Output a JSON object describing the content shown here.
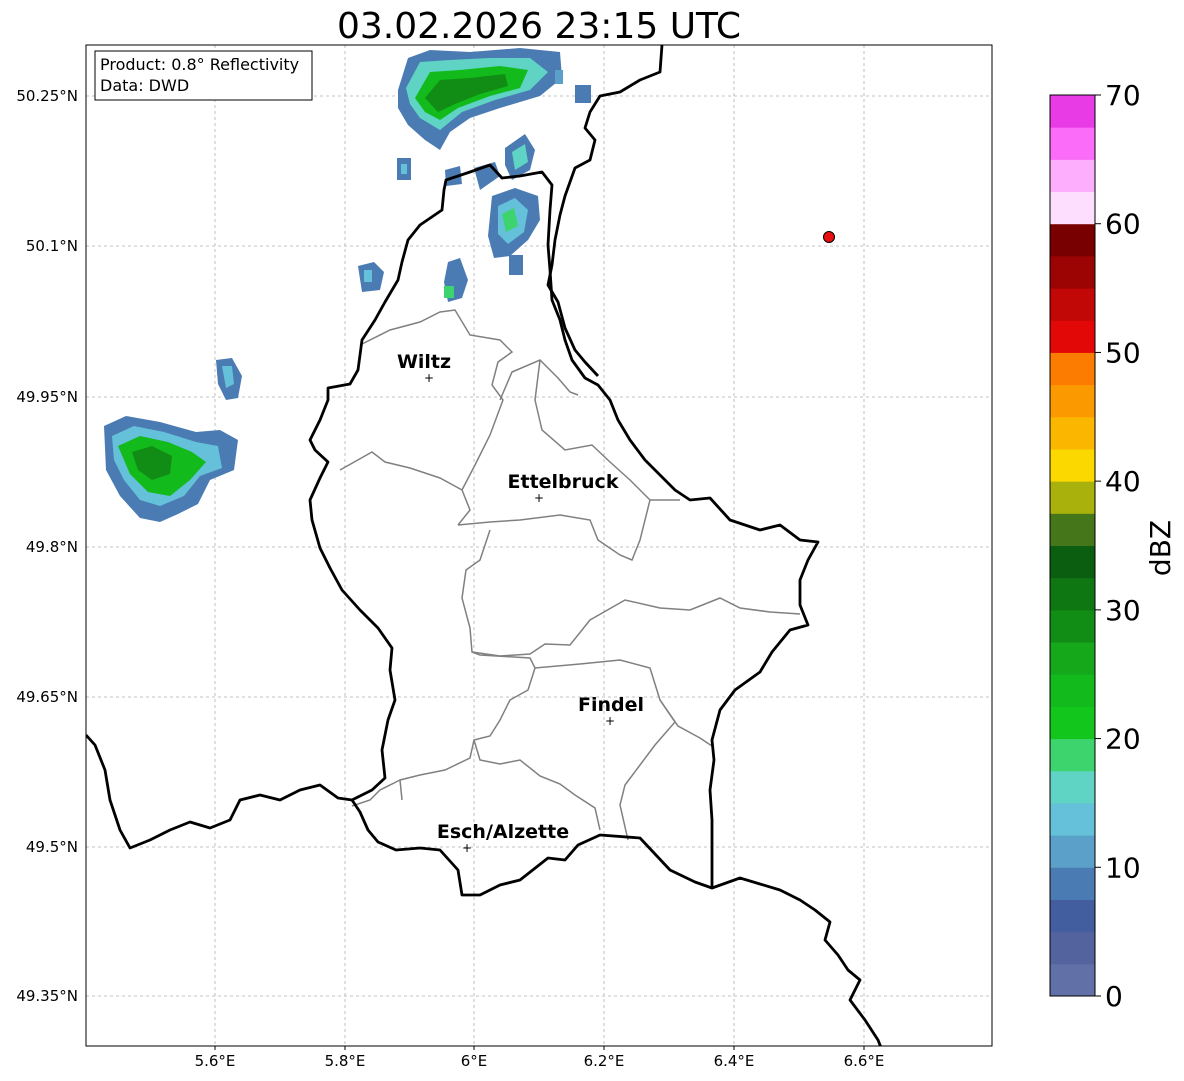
{
  "title": "03.02.2026 23:15 UTC",
  "info_box": {
    "product": "Product: 0.8° Reflectivity",
    "source": "Data: DWD"
  },
  "axes": {
    "lon_ticks": [
      "5.6°E",
      "5.8°E",
      "6°E",
      "6.2°E",
      "6.4°E",
      "6.6°E"
    ],
    "lat_ticks": [
      "50.25°N",
      "50.1°N",
      "49.95°N",
      "49.8°N",
      "49.65°N",
      "49.5°N",
      "49.35°N"
    ],
    "grid": true
  },
  "colorbar": {
    "label": "dBZ",
    "ticks": [
      "0",
      "10",
      "20",
      "30",
      "40",
      "50",
      "60",
      "70"
    ],
    "colors": [
      "#6270a8",
      "#52639e",
      "#435e9e",
      "#4b7bb3",
      "#5aa0c8",
      "#65c0d9",
      "#5fd4c4",
      "#3dd46d",
      "#13c61b",
      "#13ba1b",
      "#14a81a",
      "#118c14",
      "#0f7712",
      "#0b5e10",
      "#46761a",
      "#a9b20d",
      "#fbd800",
      "#fbb700",
      "#fb9900",
      "#fb7c00",
      "#e20808",
      "#c20707",
      "#9c0303",
      "#780000",
      "#fedeff",
      "#fdaffd",
      "#fb6cf8",
      "#e83be6"
    ]
  },
  "cities": [
    {
      "name": "Wiltz"
    },
    {
      "name": "Ettelbruck"
    },
    {
      "name": "Findel"
    },
    {
      "name": "Esch/Alzette"
    }
  ],
  "radar_marker": {
    "color": "#e81010"
  },
  "colors": {
    "border": "#000000",
    "canton_lines": "#808080",
    "grid": "#b0b0b0"
  }
}
